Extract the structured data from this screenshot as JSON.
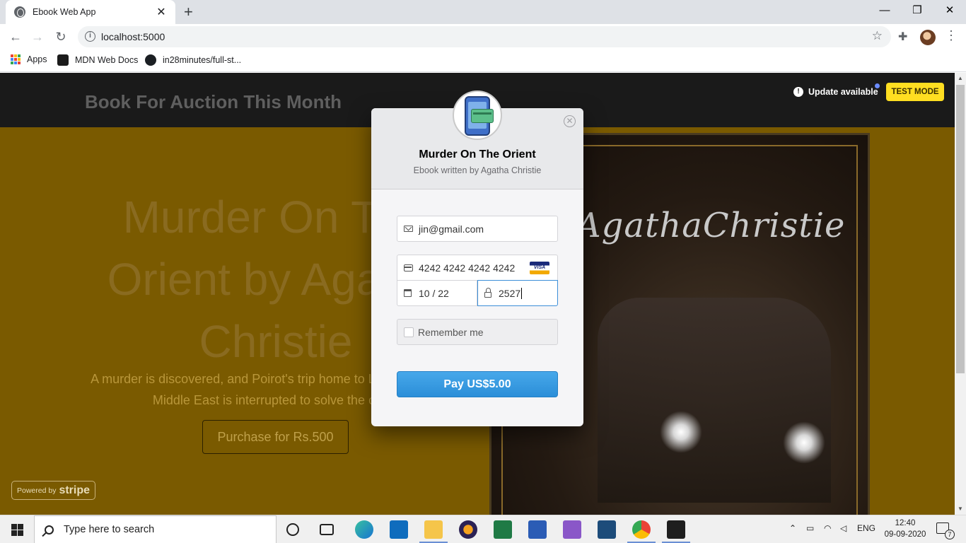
{
  "browser": {
    "tab_title": "Ebook Web App",
    "url": "localhost:5000",
    "bookmarks": [
      {
        "label": "Apps"
      },
      {
        "label": "MDN Web Docs"
      },
      {
        "label": "in28minutes/full-st..."
      }
    ]
  },
  "page": {
    "heading": "Book For Auction This Month",
    "update_label": "Update available",
    "test_mode_label": "TEST MODE",
    "hero_title": "Murder On The Orient by Agatha Christie",
    "hero_description": "A murder is discovered, and Poirot's trip home to London from the Middle East is interrupted to solve the case.",
    "purchase_label": "Purchase for Rs.500",
    "cover_author": "AgathaChristie",
    "powered_by": "Powered by",
    "stripe_word": "stripe"
  },
  "checkout": {
    "title": "Murder On The Orient",
    "subtitle": "Ebook written by Agatha Christie",
    "email": "jin@gmail.com",
    "card_number": "4242 4242 4242 4242",
    "card_brand": "VISA",
    "expiry": "10 / 22",
    "cvc": "2527",
    "remember_label": "Remember me",
    "pay_label": "Pay US$5.00",
    "accent_color": "#3b8ed8"
  },
  "taskbar": {
    "search_placeholder": "Type here to search",
    "language": "ENG",
    "time": "12:40",
    "date": "09-09-2020",
    "notification_count": "7"
  }
}
